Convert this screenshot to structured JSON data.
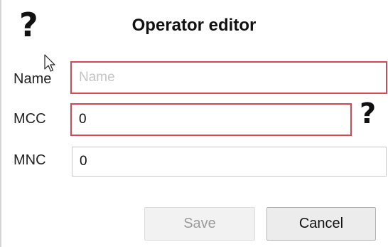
{
  "dialog": {
    "title": "Operator editor",
    "help_icon": "question-mark-icon"
  },
  "fields": {
    "name": {
      "label": "Name",
      "value": "",
      "placeholder": "Name",
      "state": "invalid"
    },
    "mcc": {
      "label": "MCC",
      "value": "0",
      "state": "invalid",
      "help_icon": "question-mark-icon"
    },
    "mnc": {
      "label": "MNC",
      "value": "0",
      "state": "normal"
    }
  },
  "buttons": {
    "save_label": "Save",
    "save_enabled": false,
    "cancel_label": "Cancel"
  },
  "colors": {
    "error_border": "#d9464d",
    "normal_border": "#c8c8c8",
    "disabled_text": "#9b9b9b"
  },
  "help_glyph": "?"
}
